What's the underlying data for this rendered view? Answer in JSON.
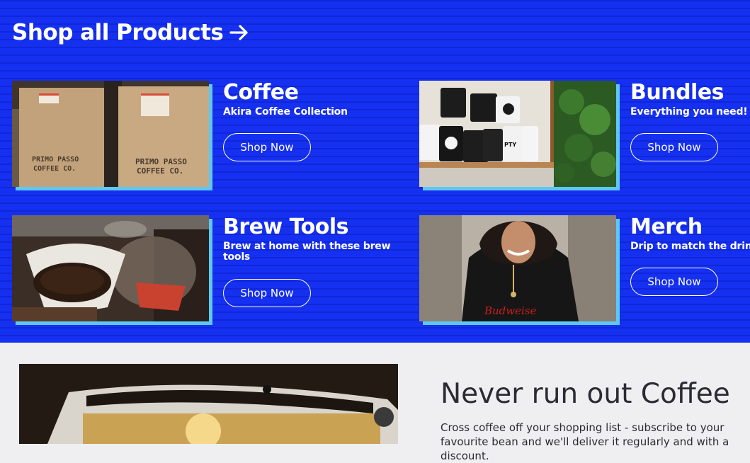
{
  "header": {
    "title": "Shop all Products"
  },
  "cards": [
    {
      "title": "Coffee",
      "subtitle": "Akira Coffee Collection",
      "button": "Shop Now"
    },
    {
      "title": "Bundles",
      "subtitle": "Everything you need!",
      "button": "Shop Now"
    },
    {
      "title": "Brew Tools",
      "subtitle": "Brew at home with these brew tools",
      "button": "Shop Now"
    },
    {
      "title": "Merch",
      "subtitle": "Drip to match the drink",
      "button": "Shop Now"
    }
  ],
  "images": {
    "coffee_bag_text_1": "PRIMO PASSO",
    "coffee_bag_text_2": "COFFEE CO.",
    "mug_text": "PTY",
    "shirt_text": "Budweise"
  },
  "subscription": {
    "title": "Never run out Coffee",
    "text": "Cross coffee off your shopping list - subscribe to your favourite bean and we'll deliver it regularly and with a discount."
  },
  "colors": {
    "hero_bg": "#1530f0",
    "card_shadow": "#5ec8f2",
    "text_dark": "#2b2b35"
  }
}
